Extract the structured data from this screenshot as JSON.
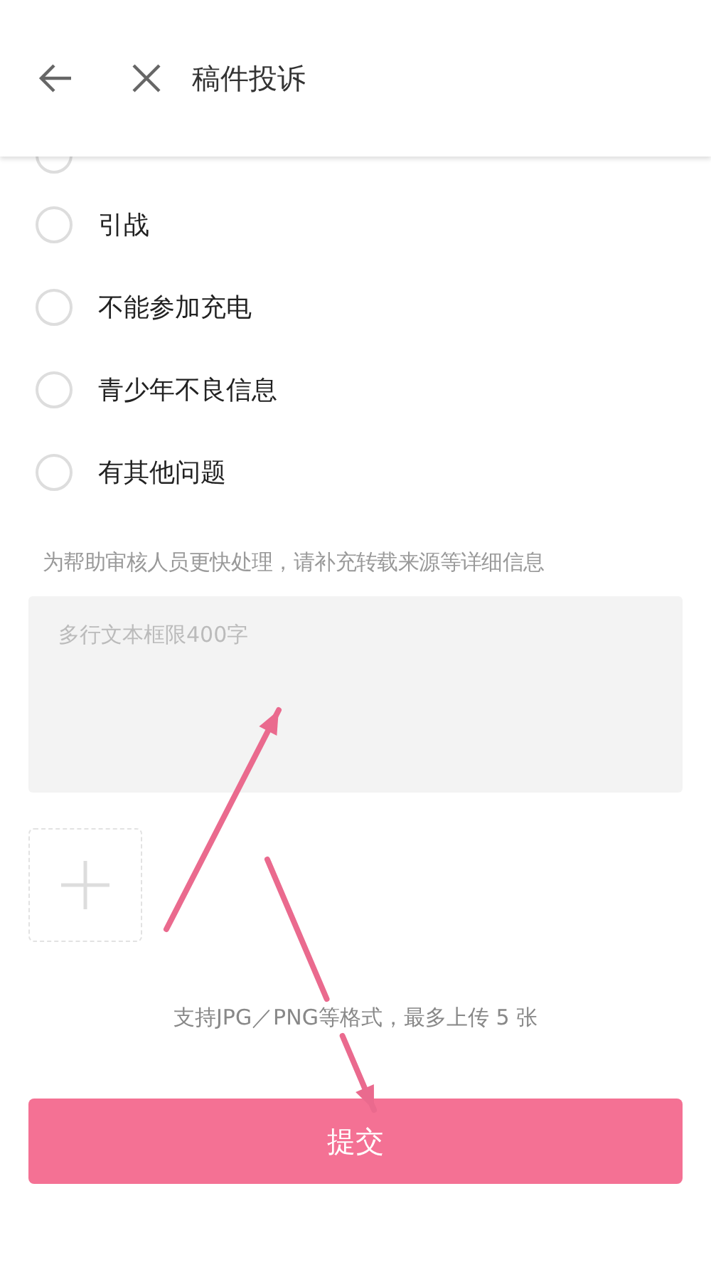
{
  "header": {
    "title": "稿件投诉"
  },
  "hidden_option": {
    "selected": false
  },
  "options": [
    {
      "label": "引战",
      "selected": false
    },
    {
      "label": "不能参加充电",
      "selected": false
    },
    {
      "label": "青少年不良信息",
      "selected": false
    },
    {
      "label": "有其他问题",
      "selected": false
    }
  ],
  "hint": "为帮助审核人员更快处理，请补充转载来源等详细信息",
  "details_field": {
    "placeholder": "多行文本框限400字"
  },
  "upload_note": "支持JPG／PNG等格式，最多上传 5 张",
  "submit_button": "提交",
  "annotations": [
    {
      "kind": "arrow"
    },
    {
      "kind": "arrow"
    }
  ]
}
